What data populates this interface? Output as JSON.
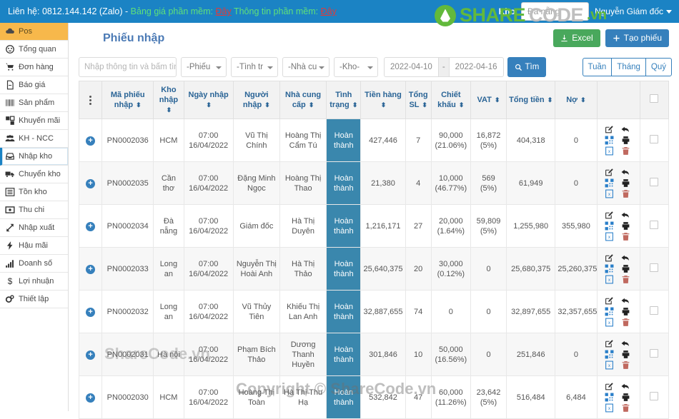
{
  "topbar": {
    "contact": "Liên hệ: 0812.144.142 (Zalo) - ",
    "price_label": "Bảng giá phần mềm: ",
    "price_link": "Đây",
    "info_label": " Thông tin phần mềm: ",
    "info_link": "Đây",
    "kho_label": "Kho",
    "kho_value": "Đà nẵng",
    "user": "Nguyễn Giám đốc"
  },
  "sidebar": {
    "items": [
      {
        "label": "Pos",
        "icon": "cloud-icon",
        "key": "pos"
      },
      {
        "label": "Tổng quan",
        "icon": "dashboard-icon",
        "key": "tongquan"
      },
      {
        "label": "Đơn hàng",
        "icon": "cart-icon",
        "key": "donhang"
      },
      {
        "label": "Báo giá",
        "icon": "file-pdf-icon",
        "key": "baogia"
      },
      {
        "label": "Sản phẩm",
        "icon": "barcode-icon",
        "key": "sanpham"
      },
      {
        "label": "Khuyến mãi",
        "icon": "promo-icon",
        "key": "khuyenmai"
      },
      {
        "label": "KH - NCC",
        "icon": "users-icon",
        "key": "khncc"
      },
      {
        "label": "Nhập kho",
        "icon": "inbox-icon",
        "key": "nhapkho"
      },
      {
        "label": "Chuyển kho",
        "icon": "truck-icon",
        "key": "chuyenkho"
      },
      {
        "label": "Tồn kho",
        "icon": "list-icon",
        "key": "tonkho"
      },
      {
        "label": "Thu chi",
        "icon": "money-icon",
        "key": "thuchi"
      },
      {
        "label": "Nhập xuất",
        "icon": "arrows-icon",
        "key": "nhapxuat"
      },
      {
        "label": "Hậu mãi",
        "icon": "bolt-icon",
        "key": "haumai"
      },
      {
        "label": "Doanh số",
        "icon": "bar-chart-icon",
        "key": "doanhso"
      },
      {
        "label": "Lợi nhuận",
        "icon": "dollar-icon",
        "key": "loinhuan"
      },
      {
        "label": "Thiết lập",
        "icon": "gears-icon",
        "key": "thietlap"
      }
    ]
  },
  "page": {
    "title": "Phiếu nhập",
    "excel_button": "Excel",
    "create_button": "Tạo phiếu"
  },
  "filters": {
    "search_placeholder": "Nhập thông tin và bấm tìm",
    "select_phieu": "-Phiếu",
    "select_tinhtrang": "-Tình tr",
    "select_nhacungcap": "-Nhà cu",
    "select_kho": "-Kho-",
    "date_from": "2022-04-10",
    "date_sep": "-",
    "date_to": "2022-04-16",
    "find_button": "Tìm",
    "period_week": "Tuần",
    "period_month": "Tháng",
    "period_quarter": "Quý"
  },
  "table": {
    "headers": [
      "",
      "Mã phiếu nhập",
      "Kho nhập",
      "Ngày nhập",
      "Người nhập",
      "Nhà cung cấp",
      "Tình trạng",
      "Tiền hàng",
      "Tổng SL",
      "Chiết khấu",
      "VAT",
      "Tổng tiền",
      "Nợ",
      "",
      ""
    ],
    "rows": [
      {
        "code": "PN0002036",
        "kho": "HCM",
        "time": "07:00",
        "date": "16/04/2022",
        "nguoi_nhap": "Vũ Thị Chính",
        "nha_cung_cap": "Hoàng Thị Cẩm Tú",
        "tinh_trang": "Hoàn thành",
        "tien_hang": "427,446",
        "tong_sl": "7",
        "chiet_khau": "90,000",
        "chiet_khau_pct": "(21.06%)",
        "vat": "16,872",
        "vat_pct": "(5%)",
        "tong_tien": "404,318",
        "no": "0"
      },
      {
        "code": "PN0002035",
        "kho": "Cần thơ",
        "time": "07:00",
        "date": "16/04/2022",
        "nguoi_nhap": "Đặng Minh Ngọc",
        "nha_cung_cap": "Hoàng Thị Thao",
        "tinh_trang": "Hoàn thành",
        "tien_hang": "21,380",
        "tong_sl": "4",
        "chiet_khau": "10,000",
        "chiet_khau_pct": "(46.77%)",
        "vat": "569 (5%)",
        "vat_pct": "",
        "tong_tien": "61,949",
        "no": "0"
      },
      {
        "code": "PN0002034",
        "kho": "Đà nẵng",
        "time": "07:00",
        "date": "16/04/2022",
        "nguoi_nhap": "Giám đốc",
        "nha_cung_cap": "Hà Thị Duyên",
        "tinh_trang": "Hoàn thành",
        "tien_hang": "1,216,171",
        "tong_sl": "27",
        "chiet_khau": "20,000",
        "chiet_khau_pct": "(1.64%)",
        "vat": "59,809",
        "vat_pct": "(5%)",
        "tong_tien": "1,255,980",
        "no": "355,980"
      },
      {
        "code": "PN0002033",
        "kho": "Long an",
        "time": "07:00",
        "date": "16/04/2022",
        "nguoi_nhap": "Nguyễn Thị Hoài Anh",
        "nha_cung_cap": "Hà Thị Thảo",
        "tinh_trang": "Hoàn thành",
        "tien_hang": "25,640,375",
        "tong_sl": "20",
        "chiet_khau": "30,000",
        "chiet_khau_pct": "(0.12%)",
        "vat": "0",
        "vat_pct": "",
        "tong_tien": "25,680,375",
        "no": "25,260,375"
      },
      {
        "code": "PN0002032",
        "kho": "Long an",
        "time": "07:00",
        "date": "16/04/2022",
        "nguoi_nhap": "Vũ Thủy Tiên",
        "nha_cung_cap": "Khiếu Thị Lan Anh",
        "tinh_trang": "Hoàn thành",
        "tien_hang": "32,887,655",
        "tong_sl": "74",
        "chiet_khau": "0",
        "chiet_khau_pct": "",
        "vat": "0",
        "vat_pct": "",
        "tong_tien": "32,897,655",
        "no": "32,357,655"
      },
      {
        "code": "PN0002031",
        "kho": "Hà nội",
        "time": "07:00",
        "date": "16/04/2022",
        "nguoi_nhap": "Phạm Bích Thảo",
        "nha_cung_cap": "Dương Thanh Huyền",
        "tinh_trang": "Hoàn thành",
        "tien_hang": "301,846",
        "tong_sl": "10",
        "chiet_khau": "50,000",
        "chiet_khau_pct": "(16.56%)",
        "vat": "0",
        "vat_pct": "",
        "tong_tien": "251,846",
        "no": "0"
      },
      {
        "code": "PN0002030",
        "kho": "HCM",
        "time": "07:00",
        "date": "16/04/2022",
        "nguoi_nhap": "Hoàng Thị Toàn",
        "nha_cung_cap": "Hà Thị Thu Hạ",
        "tinh_trang": "Hoàn thành",
        "tien_hang": "532,842",
        "tong_sl": "47",
        "chiet_khau": "60,000",
        "chiet_khau_pct": "(11.26%)",
        "vat": "23,642",
        "vat_pct": "(5%)",
        "tong_tien": "516,484",
        "no": "6,484"
      }
    ],
    "row_actions": [
      "edit-icon",
      "return-icon",
      "qrcode-icon",
      "print-icon",
      "excel-icon",
      "delete-icon"
    ]
  },
  "watermark": {
    "brand_share": "SHARE",
    "brand_code": "CODE",
    "brand_vn": ".vn",
    "mid_text": "ShareCode.vn",
    "copyright": "Copyright © ShareCode.vn"
  },
  "colors": {
    "topbar_blue": "#1b83c4",
    "accent_blue": "#3680bc",
    "status_blue": "#3a87ad",
    "excel_green": "#49a85c",
    "pos_orange": "#f7b84b"
  }
}
